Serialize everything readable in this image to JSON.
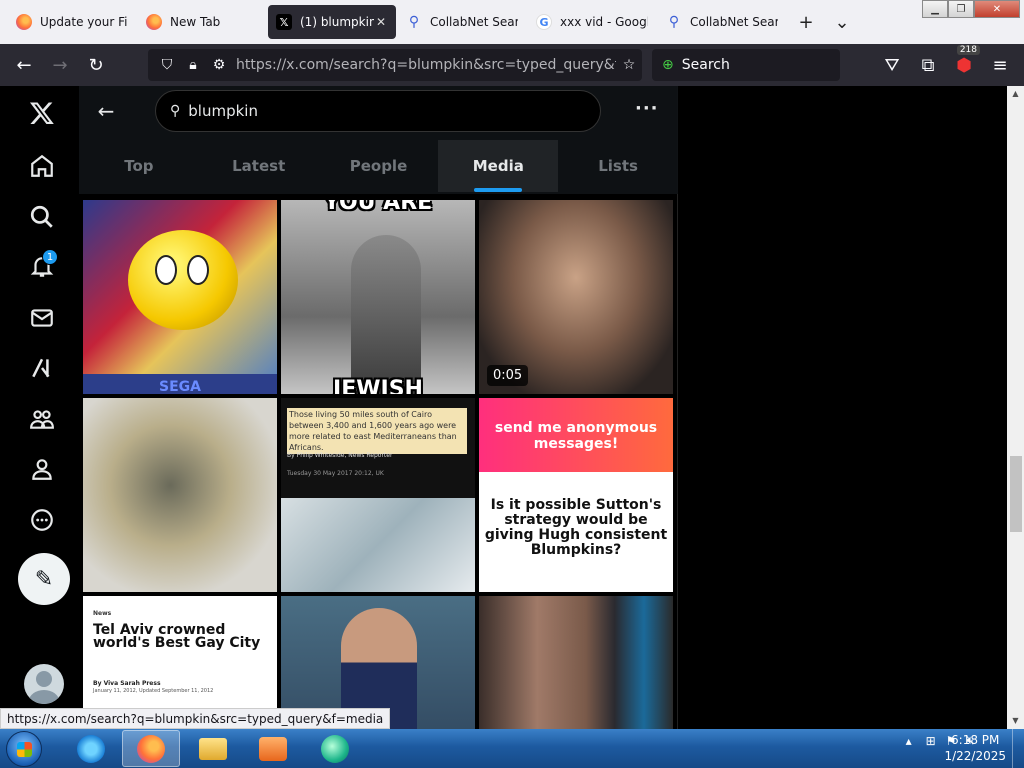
{
  "browser": {
    "tabs": [
      {
        "label": "Update your Fire",
        "favicon": "firefox-icon"
      },
      {
        "label": "New Tab",
        "favicon": "firefox-icon"
      },
      {
        "label": "(1) blumpkin",
        "favicon": "x-logo-icon",
        "active": true
      },
      {
        "label": "CollabNet SearX",
        "favicon": "collabnet-search-icon"
      },
      {
        "label": "xxx vid - Google",
        "favicon": "google-icon"
      },
      {
        "label": "CollabNet SearX",
        "favicon": "collabnet-search-icon"
      }
    ],
    "url": "https://x.com/search?q=blumpkin&src=typed_query&f=media",
    "search_placeholder": "Search",
    "extension_badge": "218",
    "status_url": "https://x.com/search?q=blumpkin&src=typed_query&f=media"
  },
  "x": {
    "search_query": "blumpkin",
    "notification_count": "1",
    "tabs": [
      {
        "label": "Top"
      },
      {
        "label": "Latest"
      },
      {
        "label": "People"
      },
      {
        "label": "Media",
        "selected": true
      },
      {
        "label": "Lists"
      }
    ],
    "media": {
      "meme_top": "YOU ARE",
      "meme_bottom": "JEWISH",
      "sega_label": "SEGA",
      "video_duration": "0:05",
      "article1_headline": "Those living 50 miles south of Cairo between 3,400 and 1,600 years ago were more related to east Mediterraneans than Africans.",
      "article1_byline": "By Philip Whiteside, News Reporter",
      "article1_date": "Tuesday 30 May 2017 20:12, UK",
      "anon_header": "send me anonymous messages!",
      "anon_question": "Is it possible Sutton's strategy would be giving Hugh consistent Blumpkins?",
      "article2_label": "News",
      "article2_headline": "Tel Aviv crowned world's Best Gay City",
      "article2_byline": "By Viva Sarah Press",
      "article2_date": "January 11, 2012, Updated September 11, 2012"
    }
  },
  "taskbar": {
    "time": "6:18 PM",
    "date": "1/22/2025"
  },
  "colors": {
    "accent": "#1d9bf0",
    "browser_chrome": "#2b2a33",
    "tab_strip": "#f0f0f4",
    "taskbar": "#1d5aa0"
  }
}
